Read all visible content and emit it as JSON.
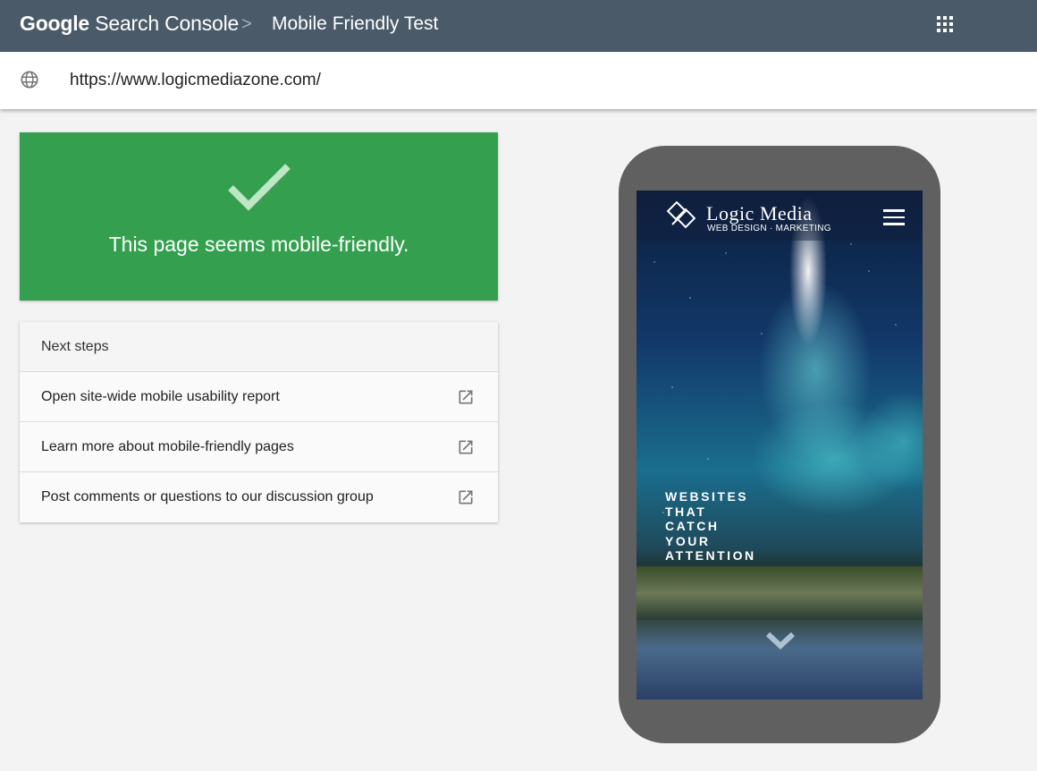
{
  "header": {
    "brand_google": "Google",
    "brand_product": "Search Console",
    "separator": ">",
    "page_title": "Mobile Friendly Test"
  },
  "url_bar": {
    "value": "https://www.logicmediazone.com/"
  },
  "result": {
    "message": "This page seems mobile-friendly.",
    "status_color": "#34a04f"
  },
  "next_steps": {
    "heading": "Next steps",
    "items": [
      {
        "label": "Open site-wide mobile usability report",
        "icon": "open-in-new-icon"
      },
      {
        "label": "Learn more about mobile-friendly pages",
        "icon": "open-in-new-icon"
      },
      {
        "label": "Post comments or questions to our discussion group",
        "icon": "open-in-new-icon"
      }
    ]
  },
  "preview": {
    "site_name": "Logic Media",
    "site_tagline": "WEB DESIGN · MARKETING",
    "hero_lines": [
      "WEBSITES",
      "THAT",
      "CATCH",
      "YOUR",
      "ATTENTION"
    ]
  },
  "icons": {
    "apps": "apps-grid-icon",
    "globe": "globe-icon",
    "check": "checkmark-icon",
    "menu": "hamburger-menu-icon",
    "scroll": "chevron-down-icon"
  },
  "colors": {
    "header_bg": "#4a5a68",
    "page_bg": "#f3f3f3",
    "phone_frame": "#606060"
  }
}
